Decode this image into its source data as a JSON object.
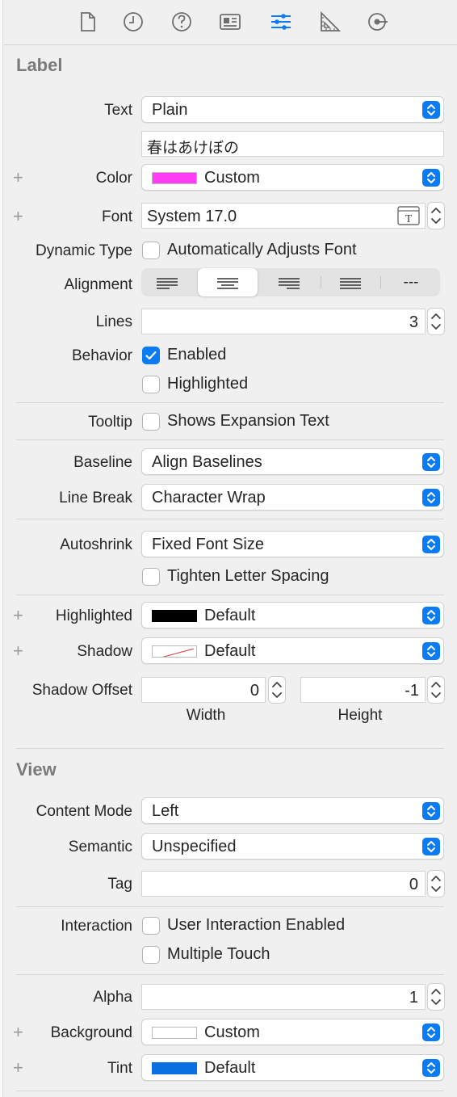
{
  "toolbar": {
    "icons": [
      "file-icon",
      "clock-icon",
      "help-icon",
      "identity-icon",
      "attributes-icon",
      "ruler-icon",
      "connections-icon"
    ],
    "active": "attributes-icon",
    "accent": "#0a7af5"
  },
  "label_section": {
    "title": "Label",
    "text": {
      "label": "Text",
      "value": "Plain",
      "content": "春はあけぼの"
    },
    "color": {
      "label": "Color",
      "value": "Custom",
      "swatch": "#ff3df5"
    },
    "font": {
      "label": "Font",
      "value": "System 17.0"
    },
    "dynamic_type": {
      "label": "Dynamic Type",
      "checkbox": "Automatically Adjusts Font",
      "checked": false
    },
    "alignment": {
      "label": "Alignment",
      "options": [
        "left",
        "center",
        "right",
        "justified",
        "natural"
      ],
      "selected": "center",
      "natural_glyph": "---"
    },
    "lines": {
      "label": "Lines",
      "value": "3"
    },
    "behavior": {
      "label": "Behavior",
      "enabled": "Enabled",
      "enabled_checked": true,
      "highlighted": "Highlighted",
      "highlighted_checked": false
    },
    "tooltip": {
      "label": "Tooltip",
      "checkbox": "Shows Expansion Text",
      "checked": false
    },
    "baseline": {
      "label": "Baseline",
      "value": "Align Baselines"
    },
    "line_break": {
      "label": "Line Break",
      "value": "Character Wrap"
    },
    "autoshrink": {
      "label": "Autoshrink",
      "value": "Fixed Font Size",
      "tighten": "Tighten Letter Spacing",
      "tighten_checked": false
    },
    "highlighted_color": {
      "label": "Highlighted",
      "value": "Default",
      "swatch": "#000000"
    },
    "shadow": {
      "label": "Shadow",
      "value": "Default"
    },
    "shadow_offset": {
      "label": "Shadow Offset",
      "width": "0",
      "height": "-1",
      "width_label": "Width",
      "height_label": "Height"
    }
  },
  "view_section": {
    "title": "View",
    "content_mode": {
      "label": "Content Mode",
      "value": "Left"
    },
    "semantic": {
      "label": "Semantic",
      "value": "Unspecified"
    },
    "tag": {
      "label": "Tag",
      "value": "0"
    },
    "interaction": {
      "label": "Interaction",
      "user_interaction": "User Interaction Enabled",
      "user_interaction_checked": false,
      "multiple_touch": "Multiple Touch",
      "multiple_touch_checked": false
    },
    "alpha": {
      "label": "Alpha",
      "value": "1"
    },
    "background": {
      "label": "Background",
      "value": "Custom",
      "swatch": "#ffffff"
    },
    "tint": {
      "label": "Tint",
      "value": "Default",
      "swatch": "#0a6fe0"
    }
  }
}
